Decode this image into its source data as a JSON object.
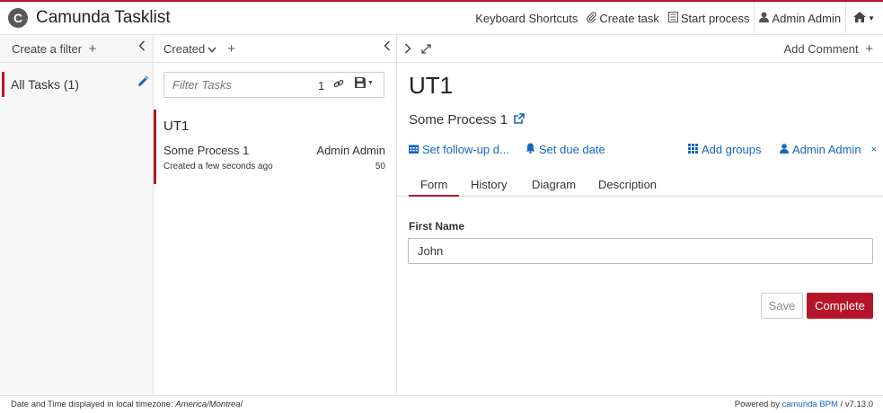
{
  "header": {
    "logo_letter": "C",
    "title": "Camunda Tasklist",
    "nav": {
      "keyboard_shortcuts": "Keyboard Shortcuts",
      "create_task": "Create task",
      "start_process": "Start process",
      "user": "Admin Admin"
    }
  },
  "filters": {
    "create_label": "Create a filter",
    "items": [
      {
        "label": "All Tasks (1)"
      }
    ]
  },
  "list": {
    "sort_label": "Created",
    "search_placeholder": "Filter Tasks",
    "search_count": "1",
    "tasks": [
      {
        "name": "UT1",
        "process": "Some Process 1",
        "assignee": "Admin Admin",
        "created": "Created a few seconds ago",
        "priority": "50"
      }
    ]
  },
  "detail": {
    "add_comment": "Add Comment",
    "title": "UT1",
    "process": "Some Process 1",
    "actions": {
      "follow_up": "Set follow-up d...",
      "due_date": "Set due date",
      "add_groups": "Add groups",
      "assignee": "Admin Admin"
    },
    "tabs": [
      {
        "label": "Form",
        "active": true
      },
      {
        "label": "History"
      },
      {
        "label": "Diagram"
      },
      {
        "label": "Description"
      }
    ],
    "form": {
      "first_name_label": "First Name",
      "first_name_value": "John",
      "save_label": "Save",
      "complete_label": "Complete"
    }
  },
  "footer": {
    "timezone_prefix": "Date and Time displayed in local timezone: ",
    "timezone": "America/Montreal",
    "powered_prefix": "Powered by ",
    "brand": "camunda BPM",
    "version": " / v7.13.0"
  },
  "colors": {
    "accent": "#b5152b",
    "link": "#1565c0"
  }
}
